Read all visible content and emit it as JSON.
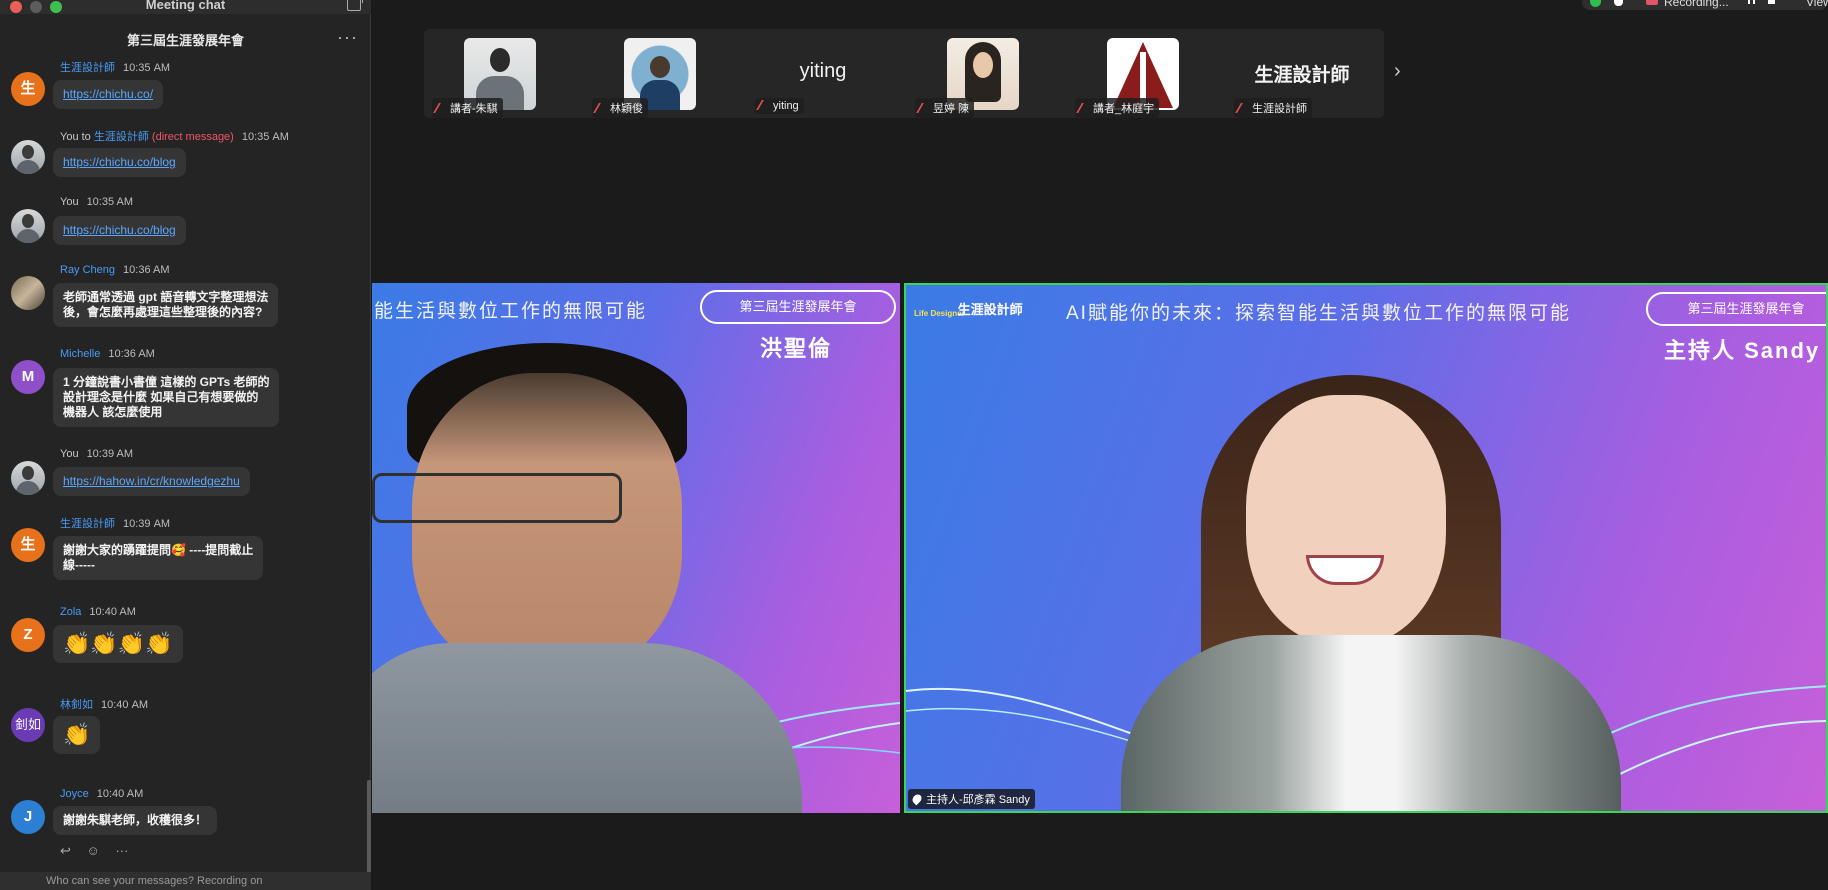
{
  "window": {
    "title": "Meeting chat"
  },
  "chat": {
    "header": "第三屆生涯發展年會",
    "more_label": "···",
    "messages": [
      {
        "avatar_text": "生",
        "sender": "生涯設計師",
        "time": "10:35 AM",
        "text": "https://chichu.co/",
        "type": "link"
      },
      {
        "avatar_text": "",
        "prefix": "You to",
        "sender": "生涯設計師",
        "dm": "(direct message)",
        "time": "10:35 AM",
        "text": "https://chichu.co/blog",
        "type": "link"
      },
      {
        "avatar_text": "",
        "sender": "You",
        "time": "10:35 AM",
        "text": "https://chichu.co/blog",
        "type": "link"
      },
      {
        "avatar_text": "",
        "sender": "Ray Cheng",
        "time": "10:36 AM",
        "text_lines": [
          "老師通常透過 gpt 語音轉文字整理想法",
          "後，會怎麼再處理這些整理後的內容?"
        ],
        "type": "text"
      },
      {
        "avatar_text": "M",
        "sender": "Michelle",
        "time": "10:36 AM",
        "text_lines": [
          "1 分鐘說書小書僮 這樣的 GPTs 老師的",
          "設計理念是什麼 如果自己有想要做的",
          "機器人 該怎麼使用"
        ],
        "type": "text"
      },
      {
        "avatar_text": "",
        "sender": "You",
        "time": "10:39 AM",
        "text": "https://hahow.in/cr/knowledgezhu",
        "type": "link"
      },
      {
        "avatar_text": "生",
        "sender": "生涯設計師",
        "time": "10:39 AM",
        "text_lines": [
          "謝謝大家的踴躍提問🥰 ----提問截止",
          "線-----"
        ],
        "type": "text"
      },
      {
        "avatar_text": "Z",
        "sender": "Zola",
        "time": "10:40 AM",
        "text": "👏👏👏👏",
        "type": "emoji"
      },
      {
        "avatar_text": "釗如",
        "sender": "林釗如",
        "time": "10:40 AM",
        "text": "👏",
        "type": "emoji"
      },
      {
        "avatar_text": "J",
        "sender": "Joyce",
        "time": "10:40 AM",
        "text": "謝謝朱騏老師，收穫很多！",
        "type": "text"
      }
    ],
    "tools": {
      "reply": "↩",
      "react": "☺",
      "more": "···"
    },
    "footer_text": "Who can see your messages? Recording on"
  },
  "topbar": {
    "recording_label": "Recording...",
    "view_label": "View"
  },
  "participants": [
    {
      "label": "講者-朱騏",
      "thumb": "person1",
      "name_text": ""
    },
    {
      "label": "林穎俊",
      "thumb": "person2",
      "name_text": ""
    },
    {
      "label": "yiting",
      "thumb": "",
      "name_text": "yiting"
    },
    {
      "label": "昱婷 陳",
      "thumb": "person3",
      "name_text": ""
    },
    {
      "label": "講者_林庭宇",
      "thumb": "logo",
      "name_text": ""
    },
    {
      "label": "生涯設計師",
      "thumb": "",
      "name_text": "生涯設計師"
    }
  ],
  "videos": {
    "left": {
      "banner": "能生活與數位工作的無限可能",
      "pill": "第三屆生涯發展年會",
      "speaker": "洪聖倫"
    },
    "right": {
      "brand_small": "Life Designer",
      "brand": "生涯設計師",
      "banner": "AI賦能你的未來：探索智能生活與數位工作的無限可能",
      "pill": "第三屆生涯發展年會",
      "speaker": "主持人 Sandy",
      "name_tag": "主持人-邱彥霖 Sandy"
    }
  },
  "colors": {
    "chat_bg": "#242424",
    "link": "#5aa6ff",
    "sender": "#4a9bf5",
    "dm": "#f0566a",
    "active_border": "#3ad65a"
  }
}
